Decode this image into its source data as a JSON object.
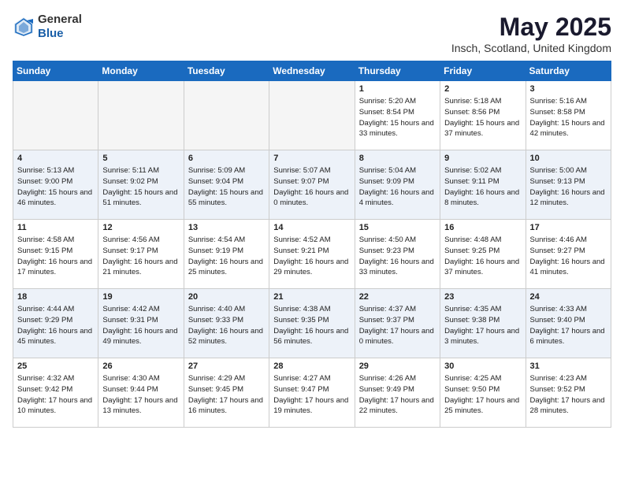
{
  "header": {
    "logo_line1": "General",
    "logo_line2": "Blue",
    "title": "May 2025",
    "subtitle": "Insch, Scotland, United Kingdom"
  },
  "weekdays": [
    "Sunday",
    "Monday",
    "Tuesday",
    "Wednesday",
    "Thursday",
    "Friday",
    "Saturday"
  ],
  "weeks": [
    [
      {
        "day": "",
        "info": ""
      },
      {
        "day": "",
        "info": ""
      },
      {
        "day": "",
        "info": ""
      },
      {
        "day": "",
        "info": ""
      },
      {
        "day": "1",
        "info": "Sunrise: 5:20 AM\nSunset: 8:54 PM\nDaylight: 15 hours\nand 33 minutes."
      },
      {
        "day": "2",
        "info": "Sunrise: 5:18 AM\nSunset: 8:56 PM\nDaylight: 15 hours\nand 37 minutes."
      },
      {
        "day": "3",
        "info": "Sunrise: 5:16 AM\nSunset: 8:58 PM\nDaylight: 15 hours\nand 42 minutes."
      }
    ],
    [
      {
        "day": "4",
        "info": "Sunrise: 5:13 AM\nSunset: 9:00 PM\nDaylight: 15 hours\nand 46 minutes."
      },
      {
        "day": "5",
        "info": "Sunrise: 5:11 AM\nSunset: 9:02 PM\nDaylight: 15 hours\nand 51 minutes."
      },
      {
        "day": "6",
        "info": "Sunrise: 5:09 AM\nSunset: 9:04 PM\nDaylight: 15 hours\nand 55 minutes."
      },
      {
        "day": "7",
        "info": "Sunrise: 5:07 AM\nSunset: 9:07 PM\nDaylight: 16 hours\nand 0 minutes."
      },
      {
        "day": "8",
        "info": "Sunrise: 5:04 AM\nSunset: 9:09 PM\nDaylight: 16 hours\nand 4 minutes."
      },
      {
        "day": "9",
        "info": "Sunrise: 5:02 AM\nSunset: 9:11 PM\nDaylight: 16 hours\nand 8 minutes."
      },
      {
        "day": "10",
        "info": "Sunrise: 5:00 AM\nSunset: 9:13 PM\nDaylight: 16 hours\nand 12 minutes."
      }
    ],
    [
      {
        "day": "11",
        "info": "Sunrise: 4:58 AM\nSunset: 9:15 PM\nDaylight: 16 hours\nand 17 minutes."
      },
      {
        "day": "12",
        "info": "Sunrise: 4:56 AM\nSunset: 9:17 PM\nDaylight: 16 hours\nand 21 minutes."
      },
      {
        "day": "13",
        "info": "Sunrise: 4:54 AM\nSunset: 9:19 PM\nDaylight: 16 hours\nand 25 minutes."
      },
      {
        "day": "14",
        "info": "Sunrise: 4:52 AM\nSunset: 9:21 PM\nDaylight: 16 hours\nand 29 minutes."
      },
      {
        "day": "15",
        "info": "Sunrise: 4:50 AM\nSunset: 9:23 PM\nDaylight: 16 hours\nand 33 minutes."
      },
      {
        "day": "16",
        "info": "Sunrise: 4:48 AM\nSunset: 9:25 PM\nDaylight: 16 hours\nand 37 minutes."
      },
      {
        "day": "17",
        "info": "Sunrise: 4:46 AM\nSunset: 9:27 PM\nDaylight: 16 hours\nand 41 minutes."
      }
    ],
    [
      {
        "day": "18",
        "info": "Sunrise: 4:44 AM\nSunset: 9:29 PM\nDaylight: 16 hours\nand 45 minutes."
      },
      {
        "day": "19",
        "info": "Sunrise: 4:42 AM\nSunset: 9:31 PM\nDaylight: 16 hours\nand 49 minutes."
      },
      {
        "day": "20",
        "info": "Sunrise: 4:40 AM\nSunset: 9:33 PM\nDaylight: 16 hours\nand 52 minutes."
      },
      {
        "day": "21",
        "info": "Sunrise: 4:38 AM\nSunset: 9:35 PM\nDaylight: 16 hours\nand 56 minutes."
      },
      {
        "day": "22",
        "info": "Sunrise: 4:37 AM\nSunset: 9:37 PM\nDaylight: 17 hours\nand 0 minutes."
      },
      {
        "day": "23",
        "info": "Sunrise: 4:35 AM\nSunset: 9:38 PM\nDaylight: 17 hours\nand 3 minutes."
      },
      {
        "day": "24",
        "info": "Sunrise: 4:33 AM\nSunset: 9:40 PM\nDaylight: 17 hours\nand 6 minutes."
      }
    ],
    [
      {
        "day": "25",
        "info": "Sunrise: 4:32 AM\nSunset: 9:42 PM\nDaylight: 17 hours\nand 10 minutes."
      },
      {
        "day": "26",
        "info": "Sunrise: 4:30 AM\nSunset: 9:44 PM\nDaylight: 17 hours\nand 13 minutes."
      },
      {
        "day": "27",
        "info": "Sunrise: 4:29 AM\nSunset: 9:45 PM\nDaylight: 17 hours\nand 16 minutes."
      },
      {
        "day": "28",
        "info": "Sunrise: 4:27 AM\nSunset: 9:47 PM\nDaylight: 17 hours\nand 19 minutes."
      },
      {
        "day": "29",
        "info": "Sunrise: 4:26 AM\nSunset: 9:49 PM\nDaylight: 17 hours\nand 22 minutes."
      },
      {
        "day": "30",
        "info": "Sunrise: 4:25 AM\nSunset: 9:50 PM\nDaylight: 17 hours\nand 25 minutes."
      },
      {
        "day": "31",
        "info": "Sunrise: 4:23 AM\nSunset: 9:52 PM\nDaylight: 17 hours\nand 28 minutes."
      }
    ]
  ]
}
